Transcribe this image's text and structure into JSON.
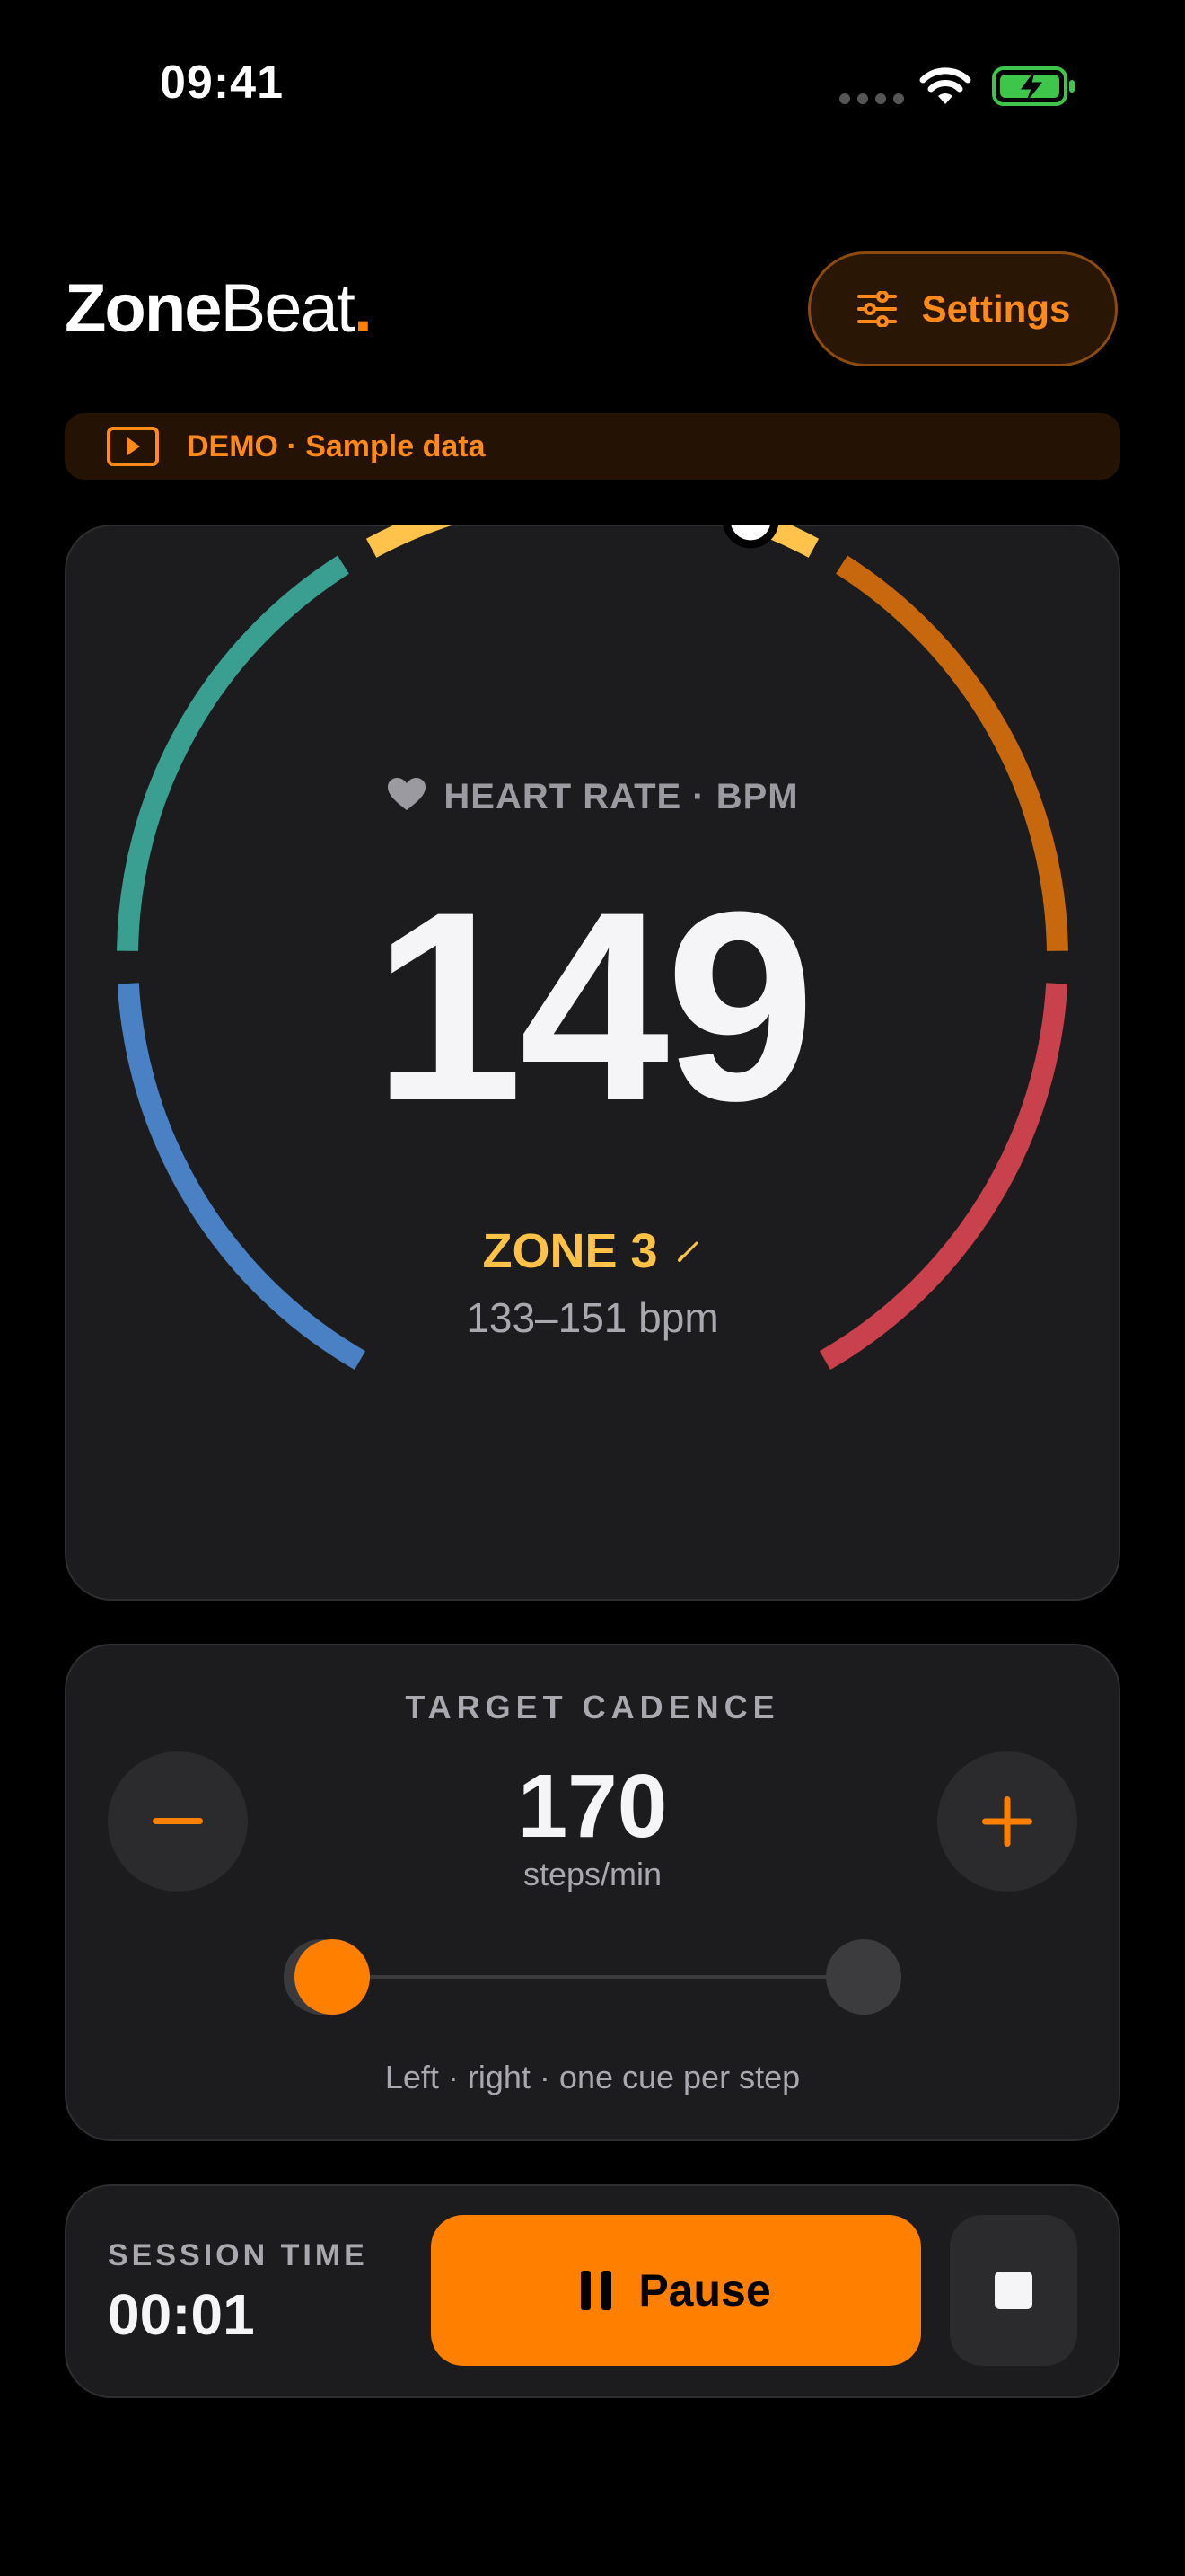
{
  "status_bar": {
    "time": "09:41",
    "icons": [
      "cellular-signal-icon",
      "wifi-icon",
      "battery-charging-icon"
    ],
    "battery_color": "#3ec64b"
  },
  "header": {
    "logo_part1": "Zone",
    "logo_part2": "Beat",
    "logo_dot": ".",
    "settings_label": "Settings",
    "settings_icon": "sliders-icon"
  },
  "demo_banner": {
    "icon": "play-icon",
    "text": "DEMO · Sample data"
  },
  "heart_rate": {
    "label": "HEART RATE · BPM",
    "icon": "heart-icon",
    "value": "149",
    "zone_label": "ZONE 3",
    "zone_range": "133–151 bpm",
    "edit_icon": "pencil-icon",
    "zone_colors": [
      "#4a80c4",
      "#3a9e90",
      "#ffc24a",
      "#c8680e",
      "#c8414c"
    ],
    "current_zone": 3,
    "indicator_position_in_zone": 0.85
  },
  "cadence": {
    "title": "TARGET CADENCE",
    "value": "170",
    "unit": "steps/min",
    "note": "Left · right · one cue per step",
    "minus_icon": "minus-icon",
    "plus_icon": "plus-icon",
    "active_side": "left"
  },
  "session": {
    "label": "SESSION TIME",
    "time": "00:01",
    "pause_label": "Pause",
    "pause_icon": "pause-icon",
    "stop_icon": "stop-icon"
  },
  "colors": {
    "accent": "#ff7f00",
    "background": "#000000",
    "card": "#1c1c1e"
  }
}
